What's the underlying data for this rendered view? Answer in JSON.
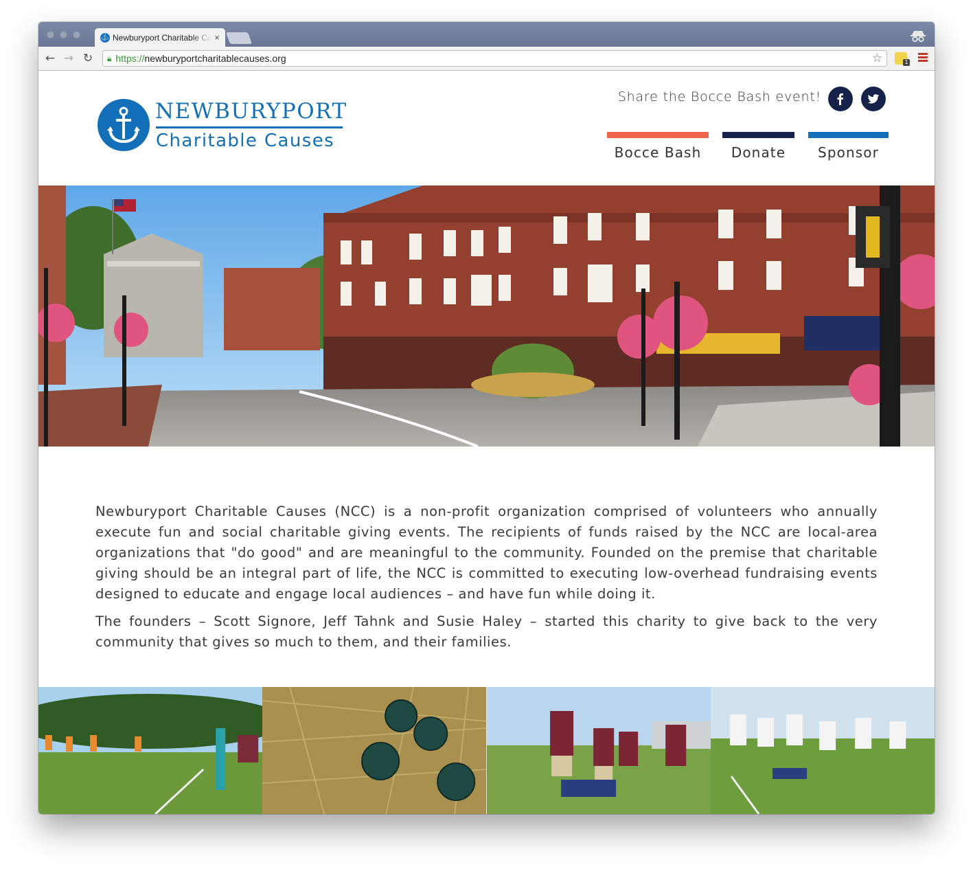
{
  "browser": {
    "tab_title": "Newburyport Charitable Causes",
    "tab_close": "×",
    "url_scheme": "https://",
    "url_host": "newburyportcharitablecauses.org",
    "ext_badge": "1"
  },
  "header": {
    "logo_line1": "NEWBURYPORT",
    "logo_line2": "Charitable Causes",
    "share_text": "Share the Bocce Bash event!"
  },
  "nav": [
    {
      "label": "Bocce Bash",
      "color": "#f0654a"
    },
    {
      "label": "Donate",
      "color": "#16224a"
    },
    {
      "label": "Sponsor",
      "color": "#1370b8"
    }
  ],
  "about": {
    "paragraph1": "Newburyport Charitable Causes (NCC) is a non-profit organization comprised of volunteers who annually execute fun and social charitable giving events. The recipients of funds raised by the NCC are local-area organizations that \"do good\" and are meaningful to the community. Founded on the premise that charitable giving should be an integral part of life, the NCC is committed to executing low-overhead fundraising events designed to educate and engage local audiences – and have fun while doing it.",
    "paragraph2": "The founders – Scott Signore, Jeff Tahnk and Susie Haley – started this charity to give back to the very community that gives so much to them, and their families."
  },
  "colors": {
    "brand_blue": "#1370b8",
    "navy": "#16224a",
    "coral": "#f0654a"
  }
}
